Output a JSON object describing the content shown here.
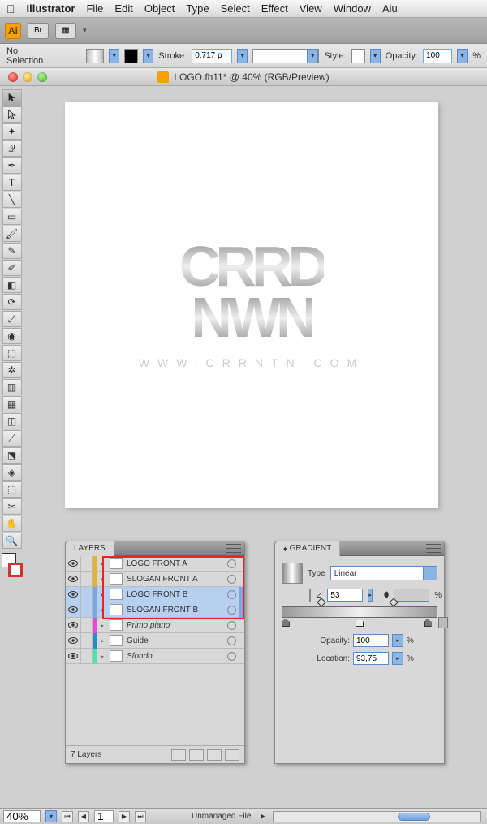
{
  "menubar": {
    "items": [
      "Illustrator",
      "File",
      "Edit",
      "Object",
      "Type",
      "Select",
      "Effect",
      "View",
      "Window",
      "Aiu"
    ]
  },
  "appbar": {
    "logo": "Ai",
    "br_label": "Br"
  },
  "ctrlbar": {
    "selection": "No Selection",
    "stroke_label": "Stroke:",
    "stroke_value": "0,717 p",
    "style_label": "Style:",
    "opacity_label": "Opacity:",
    "opacity_value": "100",
    "percent": "%"
  },
  "doc": {
    "title": "LOGO.fh11* @ 40% (RGB/Preview)"
  },
  "artwork": {
    "row1": "CRRD",
    "row2": "NWN",
    "url": "WWW.CRRNTN.COM"
  },
  "layers_panel": {
    "title": "LAYERS",
    "rows": [
      {
        "label": "LOGO FRONT A",
        "color": "#e6b031",
        "selected": false,
        "italic": false
      },
      {
        "label": "SLOGAN FRONT A",
        "color": "#e6b031",
        "selected": false,
        "italic": false
      },
      {
        "label": "LOGO FRONT B",
        "color": "#7aa6e6",
        "selected": true,
        "italic": false
      },
      {
        "label": "SLOGAN FRONT B",
        "color": "#7aa6e6",
        "selected": true,
        "italic": false
      },
      {
        "label": "Primo piano",
        "color": "#e84ad0",
        "selected": false,
        "italic": true
      },
      {
        "label": "Guide",
        "color": "#2a8cc6",
        "selected": false,
        "italic": false
      },
      {
        "label": "Sfondo",
        "color": "#4ae8a0",
        "selected": false,
        "italic": true
      }
    ],
    "footer": "7 Layers"
  },
  "gradient_panel": {
    "title": "GRADIENT",
    "type_label": "Type",
    "type_value": "Linear",
    "angle_value": "53",
    "opacity_label": "Opacity:",
    "opacity_value": "100",
    "location_label": "Location:",
    "location_value": "93,75",
    "percent": "%"
  },
  "statusbar": {
    "zoom": "40%",
    "page": "1",
    "msg": "Unmanaged File"
  }
}
